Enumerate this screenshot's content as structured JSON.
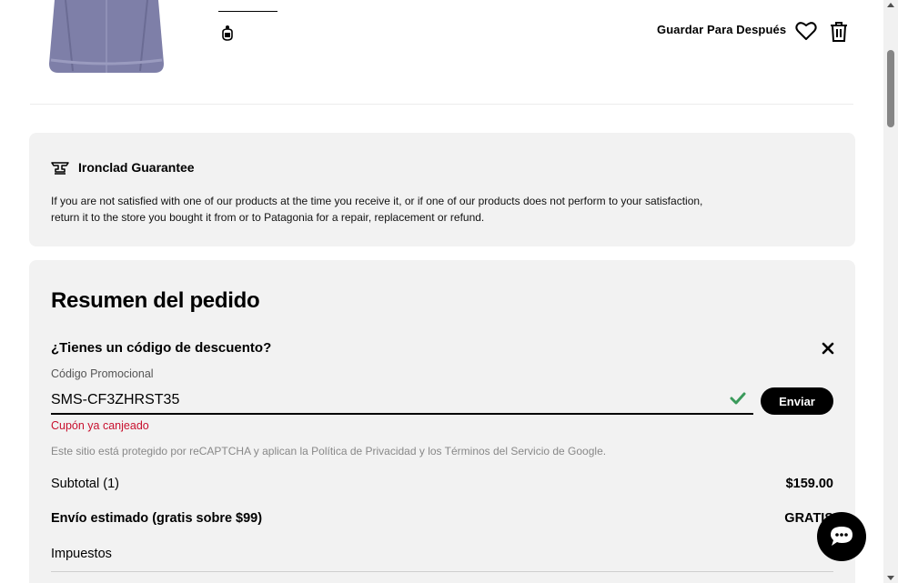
{
  "product": {
    "image_alt": "fleece jacket",
    "save_later_label": "Guardar Para Después",
    "heart_icon": "heart-icon",
    "trash_icon": "trash-icon"
  },
  "guarantee": {
    "title": "Ironclad Guarantee",
    "text": "If you are not satisfied with one of our products at the time you receive it, or if one of our products does not perform to your satisfaction, return it to the store you bought it from or to Patagonia for a repair, replacement or refund."
  },
  "summary": {
    "title": "Resumen del pedido",
    "discount_question": "¿Tienes un código de descuento?",
    "promo_label": "Código Promocional",
    "promo_value": "SMS-CF3ZHRST35",
    "send_label": "Enviar",
    "coupon_error": "Cupón ya canjeado",
    "recaptcha_text": "Este sitio está protegido por reCAPTCHA y aplican la Política de Privacidad y los Términos del Servicio de Google.",
    "subtotal_label": "Subtotal (1)",
    "subtotal_value": "$159.00",
    "shipping_label": "Envío estimado (gratis sobre $99)",
    "shipping_value": "GRATIS",
    "taxes_label": "Impuestos"
  },
  "colors": {
    "panel_bg": "#f2f2f2",
    "error": "#c8102e",
    "check": "#3a9a5b",
    "button_bg": "#000000"
  }
}
